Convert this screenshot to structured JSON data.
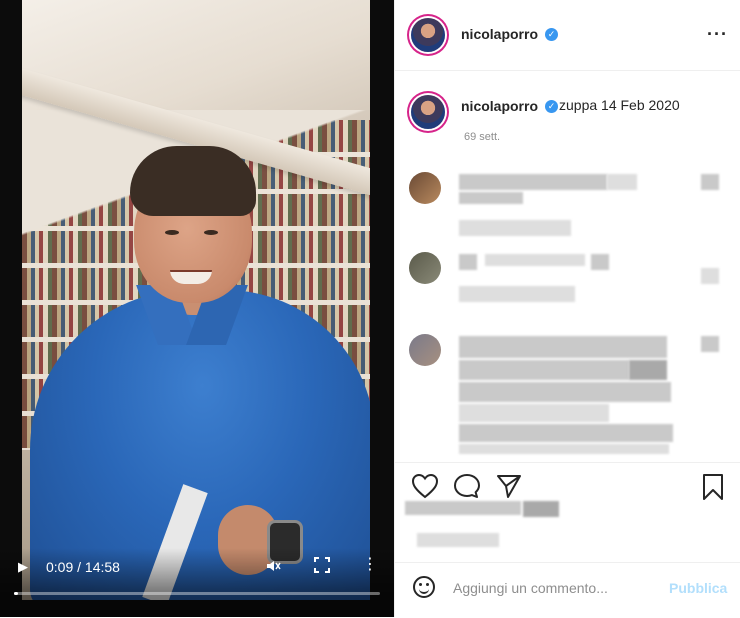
{
  "video": {
    "current_time": "0:09",
    "separator": " / ",
    "duration": "14:58",
    "progress_fraction": 0.01
  },
  "post": {
    "header": {
      "username": "nicolaporro"
    },
    "caption": {
      "username": "nicolaporro",
      "text": "zuppa 14 Feb 2020",
      "age": "69 sett."
    },
    "comment_bar": {
      "placeholder": "Aggiungi un commento...",
      "publish_label": "Pubblica"
    }
  },
  "colors": {
    "verified": "#3897f0",
    "publish_disabled": "#b2dffc",
    "story_ring": "#d6248a"
  },
  "icons": [
    "heart-icon",
    "comment-icon",
    "share-icon",
    "bookmark-icon",
    "emoji-icon",
    "more-icon",
    "play-icon",
    "volume-icon",
    "fullscreen-icon"
  ]
}
